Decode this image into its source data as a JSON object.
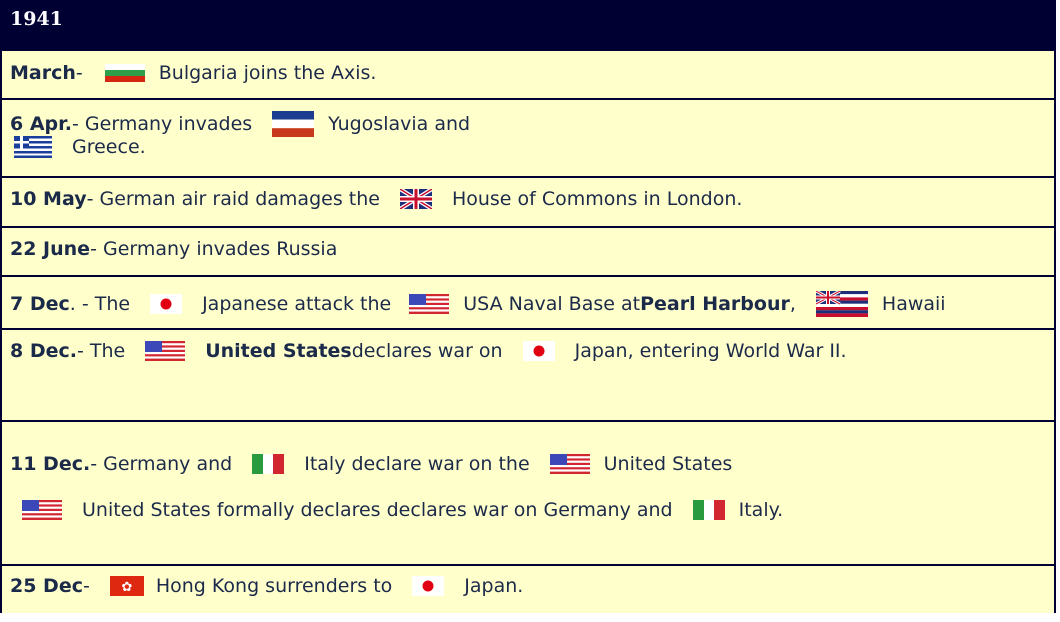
{
  "header": {
    "year": "1941"
  },
  "events": {
    "march": {
      "date": "March",
      "sep": " -",
      "text": "Bulgaria joins the Axis."
    },
    "apr": {
      "date": "6 Apr.",
      "t1": " - Germany invades",
      "t2": "Yugoslavia and",
      "t3": "Greece."
    },
    "may": {
      "date": "10 May",
      "t1": " - German air raid damages the",
      "t2": "House of Commons in London."
    },
    "june": {
      "date": "22 June",
      "t1": " - Germany invades Russia"
    },
    "dec7": {
      "date": "7 Dec",
      "t0": ". - The",
      "t1": "Japanese attack the",
      "t2": "USA Naval Base at ",
      "b1": "Pearl Harbour",
      "t3": ",",
      "t4": "Hawaii"
    },
    "dec8": {
      "date": "8 Dec.",
      "t0": " - The",
      "b1": "United States",
      "t1": " declares war on",
      "t2": "Japan, entering World War II."
    },
    "dec11": {
      "date": "11 Dec.",
      "t0": " - Germany and",
      "t1": "Italy declare war on the",
      "t2": "United States",
      "t3": "United States formally declares declares war on Germany and",
      "t4": "Italy."
    },
    "dec25": {
      "date": "25 Dec",
      "t0": " -",
      "t1": "Hong Kong surrenders to",
      "t2": "Japan."
    }
  },
  "flags": [
    "bulgaria-flag",
    "yugoslavia-flag",
    "greece-flag",
    "uk-flag",
    "japan-flag",
    "usa-flag",
    "hawaii-flag",
    "italy-flag",
    "hong-kong-flag"
  ]
}
